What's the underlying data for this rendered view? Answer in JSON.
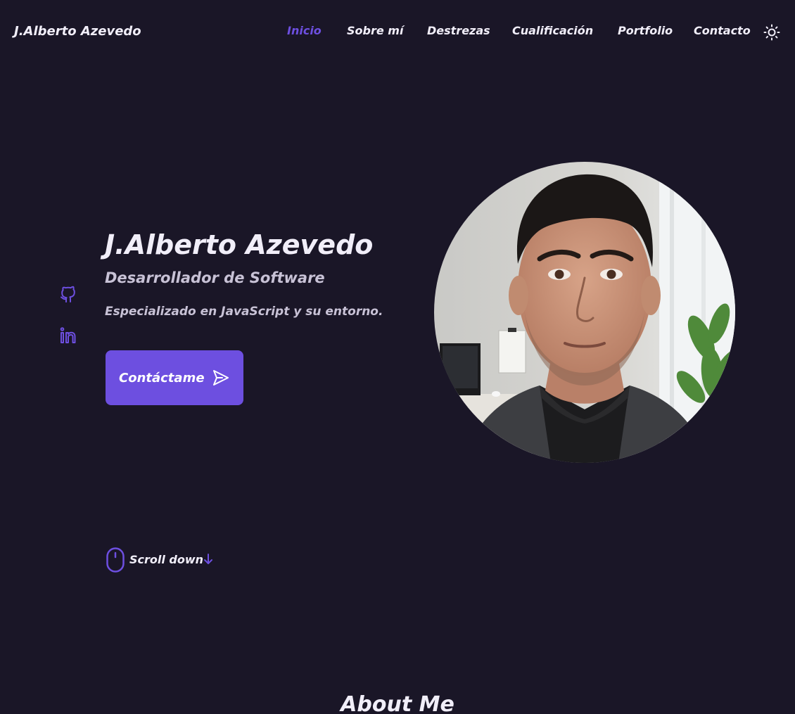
{
  "header": {
    "logo": "J.Alberto Azevedo",
    "nav": [
      {
        "label": "Inicio",
        "active": true
      },
      {
        "label": "Sobre mí",
        "active": false
      },
      {
        "label": "Destrezas",
        "active": false
      },
      {
        "label": "Cualificación",
        "active": false
      },
      {
        "label": "Portfolio",
        "active": false
      },
      {
        "label": "Contacto",
        "active": false
      }
    ],
    "theme_toggle_icon": "sun-icon"
  },
  "social": [
    {
      "icon": "github-icon"
    },
    {
      "icon": "linkedin-icon"
    }
  ],
  "hero": {
    "name": "J.Alberto Azevedo",
    "title": "Desarrollador de Software",
    "description": "Especializado en JavaScript y su entorno.",
    "cta_label": "Contáctame",
    "cta_icon": "send-icon"
  },
  "scroll": {
    "label": "Scroll down",
    "icon": "mouse-icon",
    "arrow_icon": "arrow-down-icon"
  },
  "next_section": {
    "title": "About Me"
  },
  "colors": {
    "background": "#1a1627",
    "accent": "#6d4fe0",
    "text": "#f1eef9",
    "muted_text": "#c8c2d6"
  }
}
